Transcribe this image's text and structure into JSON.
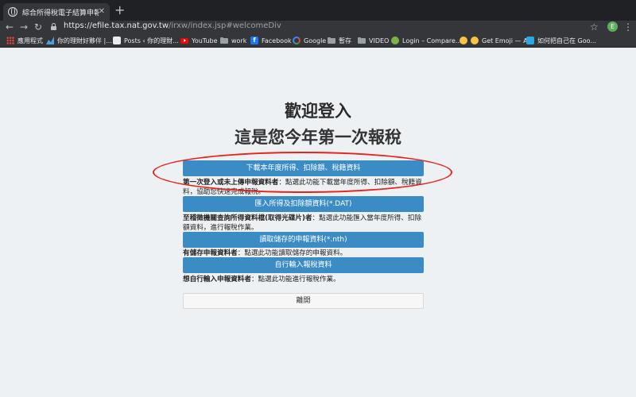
{
  "browser": {
    "tab": {
      "title": "綜合所得稅電子結算申報繳稅系統",
      "close": "✕"
    },
    "new_tab": "+",
    "nav": {
      "back": "←",
      "forward": "→",
      "reload": "↻"
    },
    "address": {
      "host": "https://efile.tax.nat.gov.tw",
      "path": "/irxw/index.jsp#welcomeDiv"
    },
    "star": "☆",
    "profile_initial": "E",
    "menu": "⋮",
    "bookmarks": [
      {
        "label": "應用程式",
        "icon": "apps-icon"
      },
      {
        "label": "你的理財好夥伴 |...",
        "icon": "chart-icon"
      },
      {
        "label": "Posts ‹ 你的理財...",
        "icon": "wordpress-icon"
      },
      {
        "label": "YouTube",
        "icon": "youtube-icon"
      },
      {
        "label": "work",
        "icon": "folder-icon"
      },
      {
        "label": "Facebook",
        "icon": "facebook-icon"
      },
      {
        "label": "Google",
        "icon": "google-icon"
      },
      {
        "label": "暫存",
        "icon": "folder-icon"
      },
      {
        "label": "VIDEO",
        "icon": "folder-icon"
      },
      {
        "label": "Login – Compare...",
        "icon": "green-circle-icon"
      },
      {
        "label": "Get Emoji — A...",
        "icon": "emoji-icon"
      },
      {
        "label": "如何把自己在 Goo...",
        "icon": "telegram-icon"
      }
    ]
  },
  "page": {
    "title": "歡迎登入",
    "subtitle": "這是您今年第一次報稅",
    "options": [
      {
        "button": "下載本年度所得、扣除額、稅籍資料",
        "desc_bold": "第一次登入或未上傳申報資料者",
        "desc": "：點選此功能下載當年度所得、扣除額、稅籍資料，協助您快速完成報稅。"
      },
      {
        "button": "匯入所得及扣除額資料(*.DAT)",
        "desc_bold": "至稽徵機關查詢所得資料檔(取得光碟片)者",
        "desc": "：點選此功能匯入當年度所得、扣除額資料，進行報稅作業。"
      },
      {
        "button": "讀取儲存的申報資料(*.nth)",
        "desc_bold": "有儲存申報資料者",
        "desc": "：點選此功能讀取儲存的申報資料。"
      },
      {
        "button": "自行輸入報稅資料",
        "desc_bold": "想自行輸入申報資料者",
        "desc": "：點選此功能進行報稅作業。"
      }
    ],
    "exit_button": "離開"
  },
  "colors": {
    "primary_button": "#3b8cc4",
    "page_background": "#edf1f4",
    "annotation": "#e8231c"
  }
}
